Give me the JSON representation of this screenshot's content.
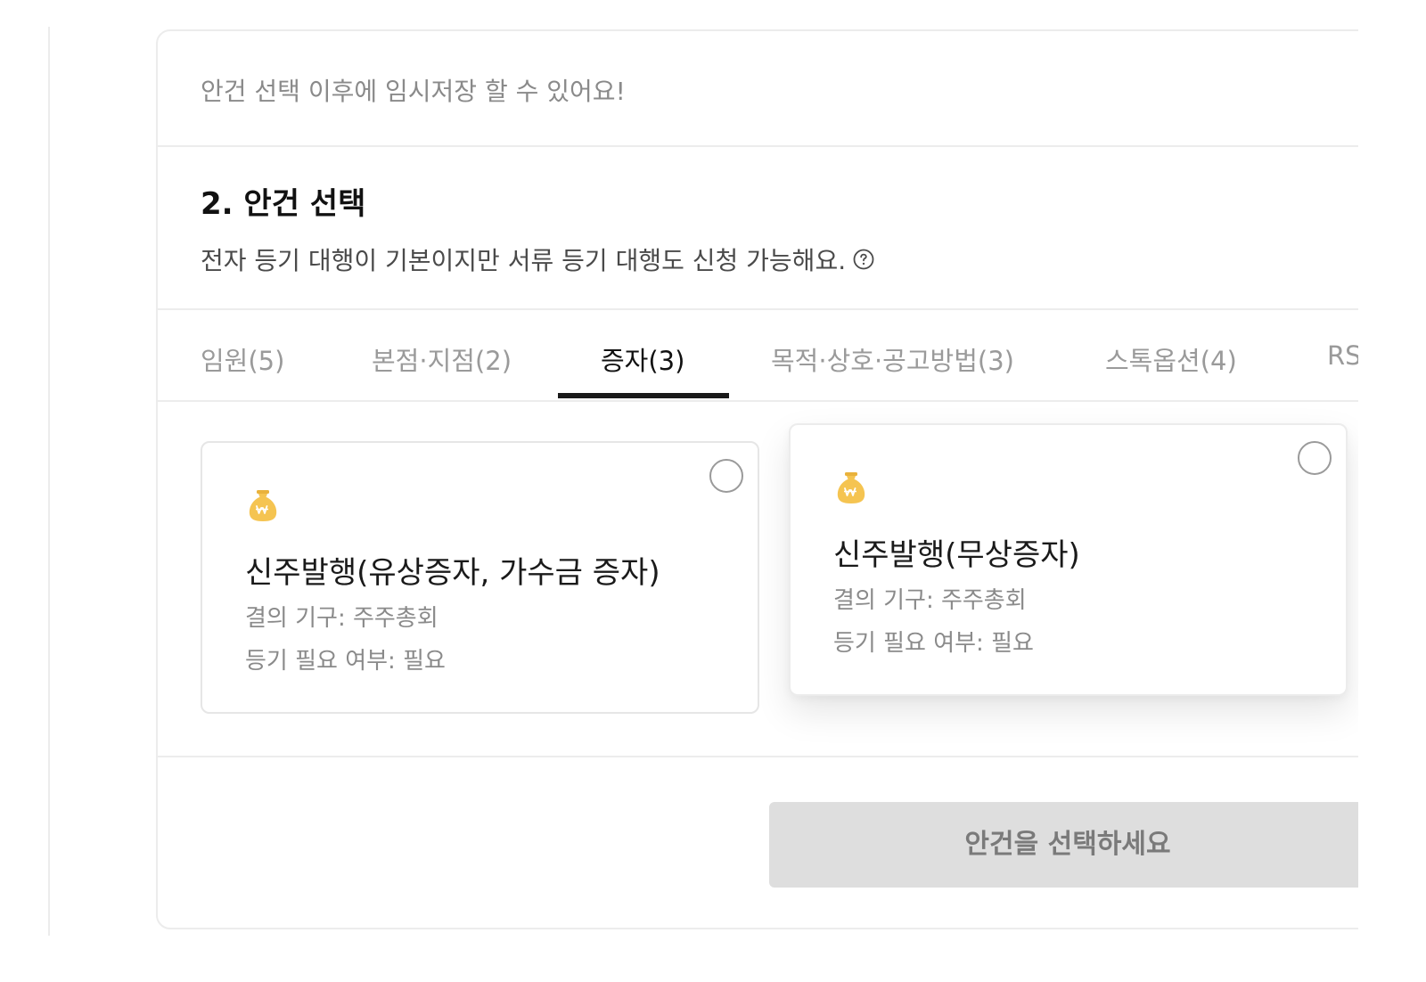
{
  "notice": {
    "text": "안건 선택 이후에 임시저장 할 수 있어요!"
  },
  "section": {
    "title": "2. 안건 선택",
    "description": "전자 등기 대행이 기본이지만 서류 등기 대행도 신청 가능해요.",
    "help_icon": "question-circle-icon"
  },
  "tabs": [
    {
      "label": "임원(5)",
      "active": false
    },
    {
      "label": "본점·지점(2)",
      "active": false
    },
    {
      "label": "증자(3)",
      "active": true
    },
    {
      "label": "목적·상호·공고방법(3)",
      "active": false
    },
    {
      "label": "스톡옵션(4)",
      "active": false
    },
    {
      "label": "RS",
      "active": false
    }
  ],
  "cards": [
    {
      "icon": "money-bag-icon",
      "title": "신주발행(유상증자, 가수금 증자)",
      "resolution": "결의 기구: 주주총회",
      "registration": "등기 필요 여부: 필요",
      "selected": false
    },
    {
      "icon": "money-bag-icon",
      "title": "신주발행(무상증자)",
      "resolution": "결의 기구: 주주총회",
      "registration": "등기 필요 여부: 필요",
      "selected": false
    }
  ],
  "cta": {
    "label": "안건을 선택하세요",
    "enabled": false
  },
  "colors": {
    "border": "#ececec",
    "muted_text": "#8a8a8a",
    "tab_active": "#111111",
    "tab_underline": "#1a1a1a",
    "money_bag": "#f5c451",
    "cta_bg": "#dedede",
    "cta_text": "#7a7a7a"
  }
}
